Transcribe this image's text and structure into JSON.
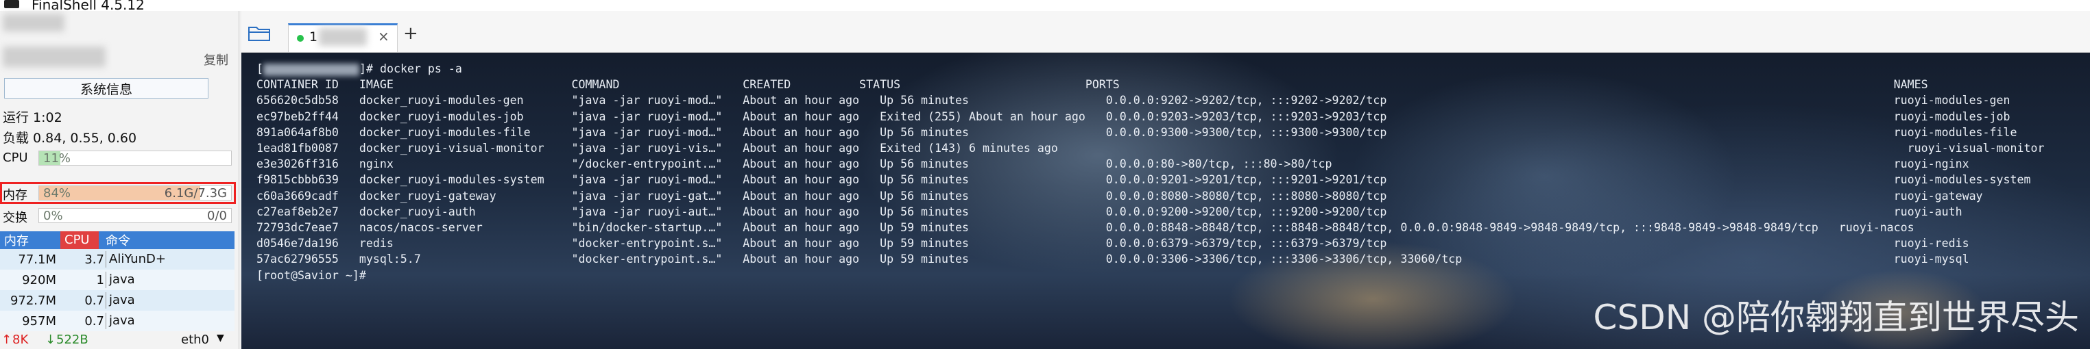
{
  "window": {
    "title": "FinalShell 4.5.12"
  },
  "left_panel": {
    "copy_label": "复制",
    "sysinfo_button": "系统信息",
    "uptime": "运行 1:02",
    "load": "负载 0.84, 0.55, 0.60",
    "cpu": {
      "label": "CPU",
      "percent": "11%",
      "fill_fraction": 0.11,
      "fill_color": "#b6e3b6"
    },
    "memory": {
      "label": "内存",
      "percent": "84%",
      "value": "6.1G/7.3G",
      "fill_fraction": 0.84,
      "fill_color": "#f5c9a8"
    },
    "swap": {
      "label": "交换",
      "percent": "0%",
      "value": "0/0",
      "fill_fraction": 0.0
    },
    "process_table": {
      "headers": {
        "mem": "内存",
        "cpu": "CPU",
        "cmd": "命令"
      },
      "rows": [
        {
          "mem": "77.1M",
          "cpu": "3.7",
          "cmd": "AliYunD+"
        },
        {
          "mem": "920M",
          "cpu": "1",
          "cmd": "java"
        },
        {
          "mem": "972.7M",
          "cpu": "0.7",
          "cmd": "java"
        },
        {
          "mem": "957M",
          "cpu": "0.7",
          "cmd": "java"
        }
      ]
    },
    "network": {
      "up": "8K",
      "down": "522B",
      "interface": "eth0"
    }
  },
  "tabs": [
    {
      "label": "1",
      "status_color": "#27c24c"
    }
  ],
  "terminal": {
    "prompt_cmd": "]# docker ps -a",
    "header": "CONTAINER ID   IMAGE                          COMMAND                  CREATED          STATUS                           PORTS                                                                                                                 NAMES",
    "rows": [
      "656620c5db58   docker_ruoyi-modules-gen       \"java -jar ruoyi-mod…\"   About an hour ago   Up 56 minutes                    0.0.0.0:9202->9202/tcp, :::9202->9202/tcp                                                                          ruoyi-modules-gen",
      "ec97beb2ff44   docker_ruoyi-modules-job       \"java -jar ruoyi-mod…\"   About an hour ago   Exited (255) About an hour ago   0.0.0.0:9203->9203/tcp, :::9203->9203/tcp                                                                          ruoyi-modules-job",
      "891a064af8b0   docker_ruoyi-modules-file      \"java -jar ruoyi-mod…\"   About an hour ago   Up 56 minutes                    0.0.0.0:9300->9300/tcp, :::9300->9300/tcp                                                                          ruoyi-modules-file",
      "1ead81fb0087   docker_ruoyi-visual-monitor    \"java -jar ruoyi-vis…\"   About an hour ago   Exited (143) 6 minutes ago                                                                                                                            ruoyi-visual-monitor",
      "e3e3026ff316   nginx                          \"/docker-entrypoint.…\"   About an hour ago   Up 56 minutes                    0.0.0.0:80->80/tcp, :::80->80/tcp                                                                                  ruoyi-nginx",
      "f9815cbbb639   docker_ruoyi-modules-system    \"java -jar ruoyi-mod…\"   About an hour ago   Up 56 minutes                    0.0.0.0:9201->9201/tcp, :::9201->9201/tcp                                                                          ruoyi-modules-system",
      "c60a3669cadf   docker_ruoyi-gateway           \"java -jar ruoyi-gat…\"   About an hour ago   Up 56 minutes                    0.0.0.0:8080->8080/tcp, :::8080->8080/tcp                                                                          ruoyi-gateway",
      "c27eaf8eb2e7   docker_ruoyi-auth              \"java -jar ruoyi-aut…\"   About an hour ago   Up 56 minutes                    0.0.0.0:9200->9200/tcp, :::9200->9200/tcp                                                                          ruoyi-auth",
      "72793dc7eae7   nacos/nacos-server             \"bin/docker-startup.…\"   About an hour ago   Up 59 minutes                    0.0.0.0:8848->8848/tcp, :::8848->8848/tcp, 0.0.0.0:9848-9849->9848-9849/tcp, :::9848-9849->9848-9849/tcp   ruoyi-nacos",
      "d0546e7da196   redis                          \"docker-entrypoint.s…\"   About an hour ago   Up 59 minutes                    0.0.0.0:6379->6379/tcp, :::6379->6379/tcp                                                                          ruoyi-redis",
      "57ac62796555   mysql:5.7                      \"docker-entrypoint.s…\"   About an hour ago   Up 59 minutes                    0.0.0.0:3306->3306/tcp, :::3306->3306/tcp, 33060/tcp                                                               ruoyi-mysql"
    ],
    "final_prompt": "[root@Savior ~]#"
  },
  "watermark": "CSDN @陪你翱翔直到世界尽头"
}
